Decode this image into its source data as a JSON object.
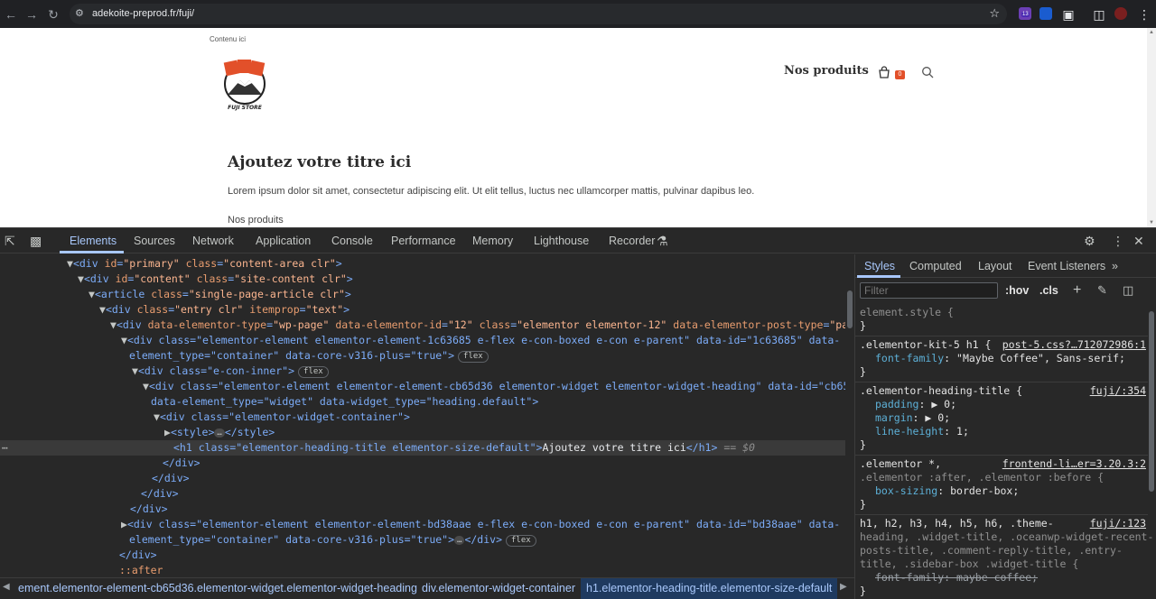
{
  "browser": {
    "url": "adekoite-preprod.fr/fuji/",
    "extension_badge": "13"
  },
  "page": {
    "skip_link": "Contenu ici",
    "logo_text": "FUJI STORE",
    "nav_link": "Nos produits",
    "cart_count": "0",
    "hero_title": "Ajoutez votre titre ici",
    "hero_text": "Lorem ipsum dolor sit amet, consectetur adipiscing elit. Ut elit tellus, luctus nec ullamcorper mattis, pulvinar dapibus leo.",
    "products_heading": "Nos produits"
  },
  "devtools": {
    "tabs": [
      "Elements",
      "Sources",
      "Network",
      "Application",
      "Console",
      "Performance",
      "Memory",
      "Lighthouse",
      "Recorder"
    ],
    "active_tab": "Elements",
    "dom_lines": {
      "l1": {
        "tag": "div",
        "attrs": [
          [
            "id",
            "primary"
          ],
          [
            "class",
            "content-area clr"
          ]
        ]
      },
      "l2": {
        "tag": "div",
        "attrs": [
          [
            "id",
            "content"
          ],
          [
            "class",
            "site-content clr"
          ]
        ]
      },
      "l3": {
        "tag": "article",
        "attrs": [
          [
            "class",
            "single-page-article clr"
          ]
        ]
      },
      "l4": {
        "tag": "div",
        "attrs": [
          [
            "class",
            "entry clr"
          ],
          [
            "itemprop",
            "text"
          ]
        ]
      },
      "l5": {
        "tag": "div",
        "attrs": [
          [
            "data-elementor-type",
            "wp-page"
          ],
          [
            "data-elementor-id",
            "12"
          ],
          [
            "class",
            "elementor elementor-12"
          ],
          [
            "data-elementor-post-type",
            "page"
          ]
        ]
      },
      "l6a": "<div class=\"elementor-element elementor-element-1c63685 e-flex e-con-boxed e-con e-parent\" data-id=\"1c63685\" data-",
      "l6b": "element_type=\"container\" data-core-v316-plus=\"true\">",
      "l7": "<div class=\"e-con-inner\">",
      "l8a": "<div class=\"elementor-element elementor-element-cb65d36 elementor-widget elementor-widget-heading\" data-id=\"cb65d36\"",
      "l8b": "data-element_type=\"widget\" data-widget_type=\"heading.default\">",
      "l9": "<div class=\"elementor-widget-container\">",
      "l10_open": "<style>",
      "l10_close": "</style>",
      "l11_open": "<h1 class=\"elementor-heading-title elementor-size-default\">",
      "l11_text": "Ajoutez votre titre ici",
      "l11_close": "</h1>",
      "l11_marker": "== $0",
      "close_div": "</div>",
      "l12a": "<div class=\"elementor-element elementor-element-bd38aae e-flex e-con-boxed e-con e-parent\" data-id=\"bd38aae\" data-",
      "l12b": "element_type=\"container\" data-core-v316-plus=\"true\">",
      "l12_close": "</div>",
      "after": "::after",
      "flex_badge": "flex",
      "ellipsis": "…"
    },
    "breadcrumbs": [
      "ement.elementor-element-cb65d36.elementor-widget.elementor-widget-heading",
      "div.elementor-widget-container",
      "h1.elementor-heading-title.elementor-size-default"
    ],
    "styles_tabs": [
      "Styles",
      "Computed",
      "Layout",
      "Event Listeners"
    ],
    "filter_placeholder": "Filter",
    "hov": ":hov",
    "cls": ".cls",
    "rules": {
      "r0_sel": "element.style {",
      "r0_close": "}",
      "r1_sel": ".elementor-kit-5 h1 {",
      "r1_src": "post-5.css?…712072986:1",
      "r1_prop": "font-family",
      "r1_val": "\"Maybe Coffee\", Sans-serif;",
      "r2_sel": ".elementor-heading-title {",
      "r2_src": "fuji/:354",
      "r2_p1": "padding",
      "r2_v1": "0;",
      "r2_p2": "margin",
      "r2_v2": "0;",
      "r2_p3": "line-height",
      "r2_v3": "1;",
      "r3_sel": ".elementor *,",
      "r3_src": "frontend-li…er=3.20.3:2",
      "r3_sel2": ".elementor :after, .elementor :before {",
      "r3_prop": "box-sizing",
      "r3_val": "border-box;",
      "r4_sel1": "h1, h2, h3, h4, h5, h6, .theme-",
      "r4_src": "fuji/:123",
      "r4_sel2": "heading, .widget-title, .oceanwp-widget-recent-",
      "r4_sel3": "posts-title, .comment-reply-title, .entry-",
      "r4_sel4": "title, .sidebar-box .widget-title {",
      "r4_prop": "font-family",
      "r4_val": "maybe coffee;"
    }
  }
}
